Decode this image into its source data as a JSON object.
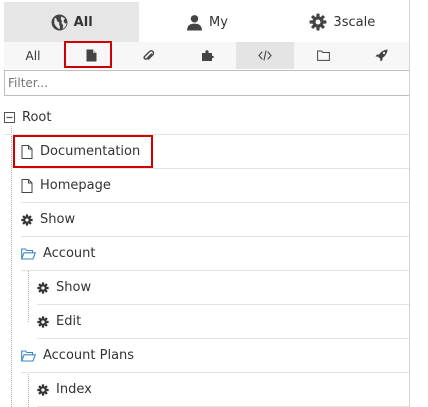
{
  "scope_tabs": [
    {
      "label": "All",
      "icon": "globe-icon",
      "active": true
    },
    {
      "label": "My",
      "icon": "user-icon",
      "active": false
    },
    {
      "label": "3scale",
      "icon": "gear-icon",
      "active": false
    }
  ],
  "type_filters": [
    {
      "label": "All",
      "icon": "",
      "active": false
    },
    {
      "label": "",
      "icon": "file-icon",
      "active": false
    },
    {
      "label": "",
      "icon": "paperclip-icon",
      "active": false
    },
    {
      "label": "",
      "icon": "puzzle-icon",
      "active": false
    },
    {
      "label": "",
      "icon": "code-icon",
      "active": true
    },
    {
      "label": "",
      "icon": "folder-icon",
      "active": false
    },
    {
      "label": "",
      "icon": "rocket-icon",
      "active": false
    }
  ],
  "search": {
    "placeholder": "Filter..."
  },
  "tree": [
    {
      "label": "Root",
      "icon": "collapse-icon",
      "level": 0
    },
    {
      "label": "Documentation",
      "icon": "file-icon",
      "level": 1,
      "highlighted": true
    },
    {
      "label": "Homepage",
      "icon": "file-icon",
      "level": 1
    },
    {
      "label": "Show",
      "icon": "gear-icon",
      "level": 1
    },
    {
      "label": "Account",
      "icon": "folder-open-icon",
      "level": 1
    },
    {
      "label": "Show",
      "icon": "gear-icon",
      "level": 2
    },
    {
      "label": "Edit",
      "icon": "gear-icon",
      "level": 2
    },
    {
      "label": "Account Plans",
      "icon": "folder-open-icon",
      "level": 1
    },
    {
      "label": "Index",
      "icon": "gear-icon",
      "level": 2
    }
  ],
  "colors": {
    "highlight": "#d20000",
    "folder": "#3a87c8"
  }
}
